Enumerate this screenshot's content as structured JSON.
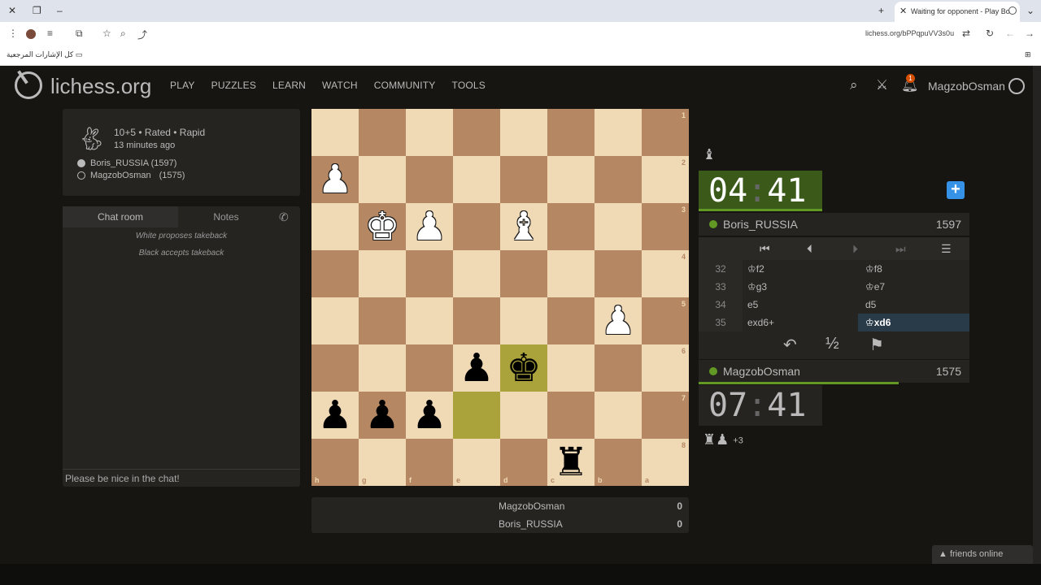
{
  "browser": {
    "tab_title": "Waiting for opponent - Play Bo",
    "url": "lichess.org/bPPqpuVV3s0u",
    "bookmarks_label": "كل الإشارات المرجعية"
  },
  "header": {
    "logo": "lichess.org",
    "nav": [
      "PLAY",
      "PUZZLES",
      "LEARN",
      "WATCH",
      "COMMUNITY",
      "TOOLS"
    ],
    "notification_count": "1",
    "username": "MagzobOsman"
  },
  "game_info": {
    "setup": "10+5 • Rated • Rapid",
    "time_ago": "13 minutes ago",
    "white_player": "Boris_RUSSIA (1597)",
    "black_player_name": "MagzobOsman",
    "black_player_rating": "(1575)"
  },
  "chat": {
    "tab_chat": "Chat room",
    "tab_notes": "Notes",
    "messages": [
      "White proposes takeback",
      "Black accepts takeback"
    ],
    "input_placeholder": "Please be nice in the chat!"
  },
  "board": {
    "rank_labels": [
      "1",
      "2",
      "3",
      "4",
      "5",
      "6",
      "7",
      "8"
    ],
    "file_labels": [
      "h",
      "g",
      "f",
      "e",
      "d",
      "c",
      "b",
      "a"
    ],
    "pieces": [
      {
        "glyph": "♟",
        "color": "white",
        "square": "h2"
      },
      {
        "glyph": "♚",
        "color": "white",
        "square": "g3"
      },
      {
        "glyph": "♟",
        "color": "white",
        "square": "f3"
      },
      {
        "glyph": "♝",
        "color": "white",
        "square": "d3"
      },
      {
        "glyph": "♟",
        "color": "white",
        "square": "b5"
      },
      {
        "glyph": "♟",
        "color": "black",
        "square": "e6"
      },
      {
        "glyph": "♚",
        "color": "black",
        "square": "d6"
      },
      {
        "glyph": "♟",
        "color": "black",
        "square": "h7"
      },
      {
        "glyph": "♟",
        "color": "black",
        "square": "g7"
      },
      {
        "glyph": "♟",
        "color": "black",
        "square": "f7"
      },
      {
        "glyph": "♜",
        "color": "black",
        "square": "c8"
      }
    ],
    "highlights": [
      "d6",
      "e7"
    ]
  },
  "crosstable": {
    "rows": [
      {
        "name": "MagzobOsman",
        "score": "0"
      },
      {
        "name": "Boris_RUSSIA",
        "score": "0"
      }
    ]
  },
  "clocks": {
    "top": {
      "minutes": "04",
      "seconds": "41"
    },
    "bottom": {
      "minutes": "07",
      "seconds": "41"
    }
  },
  "players": {
    "top": {
      "name": "Boris_RUSSIA",
      "rating": "1597"
    },
    "bottom": {
      "name": "MagzobOsman",
      "rating": "1575"
    }
  },
  "bottom_clock_progress": 0.74,
  "moves": [
    {
      "num": "32",
      "white": "♔f2",
      "black": "♔f8"
    },
    {
      "num": "33",
      "white": "♔g3",
      "black": "♔e7"
    },
    {
      "num": "34",
      "white": "e5",
      "black": "d5"
    },
    {
      "num": "35",
      "white": "exd6+",
      "black": "♔xd6"
    }
  ],
  "actions": {
    "takeback": "↶",
    "draw": "½",
    "resign": "⚑"
  },
  "captured": {
    "top": "♝",
    "bottom": "♜♟",
    "bottom_diff": "+3"
  },
  "friends_label": "▲ friends online",
  "colors": {
    "board_light": "#f0d9b5",
    "board_dark": "#b58863",
    "highlight": "#aaa23a",
    "online_green": "#629924",
    "accent_blue": "#3692e7"
  }
}
